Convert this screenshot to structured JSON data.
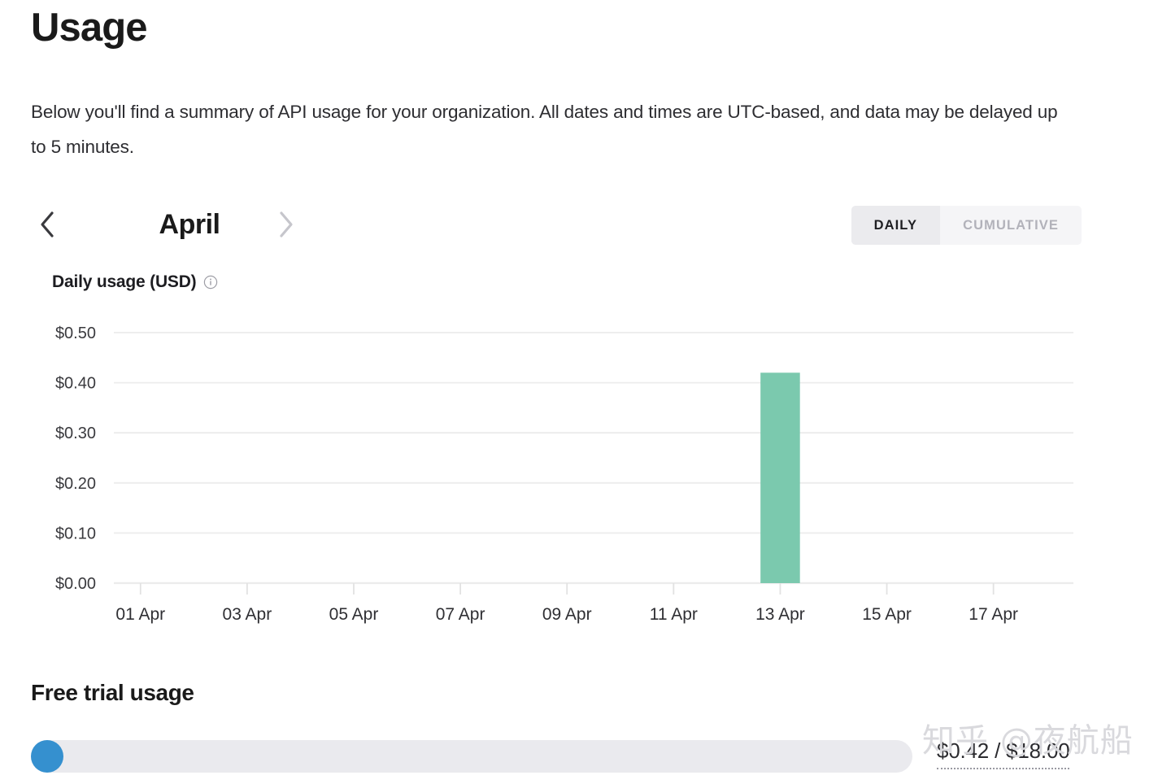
{
  "page": {
    "title": "Usage",
    "intro": "Below you'll find a summary of API usage for your organization. All dates and times are UTC-based, and data may be delayed up to 5 minutes."
  },
  "nav": {
    "prev_label": "‹",
    "next_label": "›",
    "month": "April",
    "prev_icon": "chevron-left-icon",
    "next_icon": "chevron-right-icon",
    "prev_color": "#3a3a3e",
    "next_color": "#c6c6cc"
  },
  "toggle": {
    "options": [
      {
        "label": "DAILY",
        "selected": true
      },
      {
        "label": "CUMULATIVE",
        "selected": false
      }
    ],
    "daily_label": "DAILY",
    "cumulative_label": "CUMULATIVE",
    "active_bg": "#ebebee",
    "inactive_bg": "#f5f5f7"
  },
  "chart_section": {
    "heading": "Daily usage (USD)",
    "info_icon": "info-circle-icon"
  },
  "chart_data": {
    "type": "bar",
    "title": "Daily usage (USD)",
    "xlabel": "",
    "ylabel": "",
    "ylim": [
      0,
      0.5
    ],
    "ytick_labels": [
      "$0.50",
      "$0.40",
      "$0.30",
      "$0.20",
      "$0.10",
      "$0.00"
    ],
    "ytick_values": [
      0.5,
      0.4,
      0.3,
      0.2,
      0.1,
      0.0
    ],
    "xtick_labels": [
      "01 Apr",
      "03 Apr",
      "05 Apr",
      "07 Apr",
      "09 Apr",
      "11 Apr",
      "13 Apr",
      "15 Apr",
      "17 Apr"
    ],
    "categories": [
      "01 Apr",
      "02 Apr",
      "03 Apr",
      "04 Apr",
      "05 Apr",
      "06 Apr",
      "07 Apr",
      "08 Apr",
      "09 Apr",
      "10 Apr",
      "11 Apr",
      "12 Apr",
      "13 Apr",
      "14 Apr",
      "15 Apr",
      "16 Apr",
      "17 Apr",
      "18 Apr"
    ],
    "values": [
      0,
      0,
      0,
      0,
      0,
      0,
      0,
      0,
      0,
      0,
      0,
      0,
      0.42,
      0,
      0,
      0,
      0,
      0
    ],
    "bar_color": "#7bc9ae",
    "grid": true,
    "grid_color": "#ececec",
    "legend": "none"
  },
  "free_trial": {
    "title": "Free trial usage",
    "value_text": "$0.42 / $18.00",
    "used": 0.42,
    "total": 18.0,
    "percent": 2.3,
    "fill_color": "#3590cf",
    "track_color": "#eaeaee"
  },
  "watermark": {
    "text": "知乎 @夜航船"
  }
}
